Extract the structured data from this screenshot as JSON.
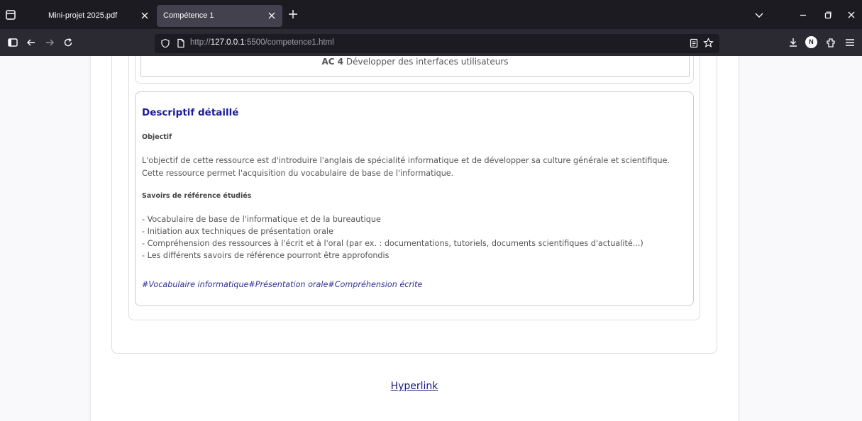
{
  "browser": {
    "tabs": [
      {
        "title": "Mini-projet 2025.pdf",
        "active": false
      },
      {
        "title": "Compétence 1",
        "active": true
      }
    ],
    "url": {
      "scheme": "http://",
      "host": "127.0.0.1",
      "rest": ":5500/competence1.html"
    },
    "profile_initial": "N"
  },
  "content": {
    "ac": {
      "code": "AC 4",
      "label": "Développer des interfaces utilisateurs"
    },
    "detail": {
      "title": "Descriptif détaillé",
      "objective_heading": "Objectif",
      "objective_text": "L'objectif de cette ressource est d'introduire l'anglais de spécialité informatique et de développer sa culture générale et scientifique. Cette ressource permet l'acquisition du vocabulaire de base de l'informatique.",
      "knowledge_heading": "Savoirs de référence étudiés",
      "knowledge_items": [
        "- Vocabulaire de base de l'informatique et de la bureautique",
        "- Initiation aux techniques de présentation orale",
        "- Compréhension des ressources à l'écrit et à l'oral (par ex. : documentations, tutoriels, documents scientifiques d'actualité...)",
        "- Les différents savoirs de référence pourront être approfondis"
      ],
      "tags": "#Vocabulaire informatique#Présentation orale#Compréhension écrite"
    },
    "footer_link": "Hyperlink"
  }
}
